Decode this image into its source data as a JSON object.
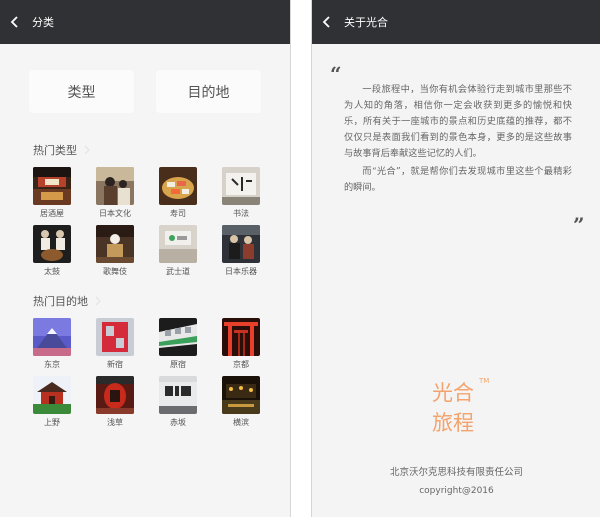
{
  "left_screen": {
    "nav_title": "分类",
    "segments": {
      "type_label": "类型",
      "destination_label": "目的地"
    },
    "hot_types": {
      "title": "热门类型",
      "items": [
        {
          "label": "居酒屋",
          "icon": "izakaya-photo"
        },
        {
          "label": "日本文化",
          "icon": "japanese-culture-photo"
        },
        {
          "label": "寿司",
          "icon": "sushi-photo"
        },
        {
          "label": "书法",
          "icon": "calligraphy-photo"
        },
        {
          "label": "太鼓",
          "icon": "taiko-photo"
        },
        {
          "label": "歌舞伎",
          "icon": "kabuki-photo"
        },
        {
          "label": "武士道",
          "icon": "bushido-photo"
        },
        {
          "label": "日本乐器",
          "icon": "japanese-instrument-photo"
        }
      ]
    },
    "hot_destinations": {
      "title": "热门目的地",
      "items": [
        {
          "label": "东京",
          "icon": "tokyo-photo"
        },
        {
          "label": "新宿",
          "icon": "shinjuku-photo"
        },
        {
          "label": "原宿",
          "icon": "harajuku-photo"
        },
        {
          "label": "京都",
          "icon": "kyoto-photo"
        },
        {
          "label": "上野",
          "icon": "ueno-photo"
        },
        {
          "label": "浅草",
          "icon": "asakusa-photo"
        },
        {
          "label": "赤坂",
          "icon": "akasaka-photo"
        },
        {
          "label": "横滨",
          "icon": "yokohama-photo"
        }
      ]
    }
  },
  "right_screen": {
    "nav_title": "关于光合",
    "quote_open": "“",
    "quote_close": "”",
    "paragraphs": [
      "一段旅程中，当你有机会体验行走到城市里那些不为人知的角落，相信你一定会收获到更多的愉悦和快乐，所有关于一座城市的景点和历史底蕴的推荐，都不仅仅只是表面我们看到的景色本身，更多的是这些故事与故事背后奉献这些记忆的人们。",
      "而“光合”，就是帮你们去发现城市里这些个最精彩的瞬间。"
    ],
    "logo": {
      "line1": "光合",
      "line2": "旅程",
      "tm": "TM"
    },
    "company": "北京沃尔克思科技有限责任公司",
    "copyright": "copyright@2016"
  },
  "colors": {
    "navbar": "#2f3135",
    "accent_orange": "#f4a36c",
    "background": "#f5f5f5"
  }
}
